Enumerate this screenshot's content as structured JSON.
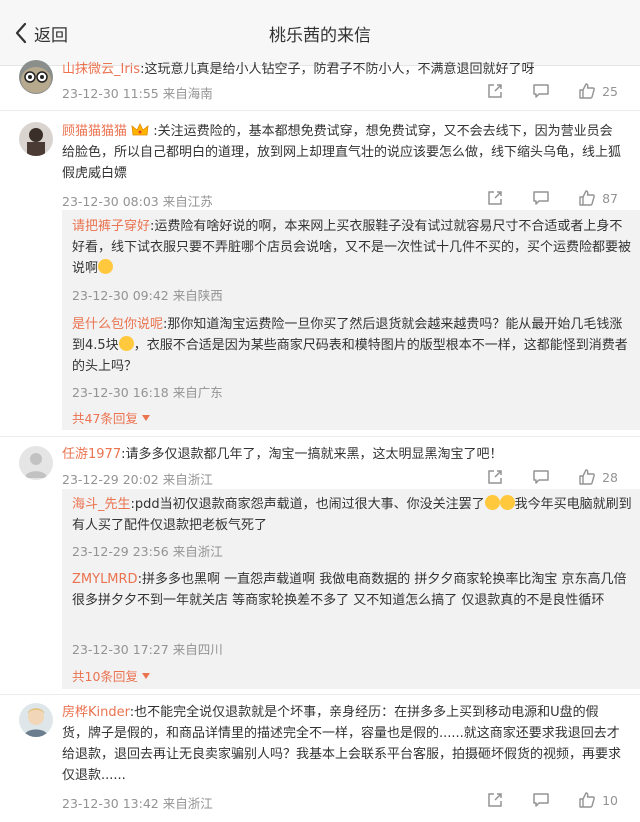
{
  "header": {
    "back_label": "返回",
    "title": "桃乐茜的来信"
  },
  "comments": [
    {
      "user": "山抹微云_Iris",
      "text": ":这玩意儿真是给小人钻空子，防君子不防小人，不满意退回就好了呀",
      "time": "23-12-30 11:55 来自海南",
      "likes": "25"
    },
    {
      "user": "顾猫猫猫猫",
      "text": ":关注运费险的，基本都想免费试穿，想免费试穿，又不会去线下，因为营业员会给脸色，所以自己都明白的道理，放到网上却理直气壮的说应该要怎么做，线下缩头乌龟，线上狐假虎威白嫖",
      "time": "23-12-30 08:03 来自江苏",
      "likes": "87",
      "replies": [
        {
          "user": "请把裤子穿好",
          "text": ":运费险有啥好说的啊，本来网上买衣服鞋子没有试过就容易尺寸不合适或者上身不好看，线下试衣服只要不弄脏哪个店员会说啥，又不是一次性试十几件不买的，买个运费险都要被说啊",
          "time": "23-12-30 09:42 来自陕西"
        },
        {
          "user": "是什么包你说呢",
          "text_a": ":那你知道淘宝运费险一旦你买了然后退货就会越来越贵吗？能从最开始几毛钱涨到4.5块",
          "text_b": "，衣服不合适是因为某些商家尺码表和模特图片的版型根本不一样，这都能怪到消费者的头上吗？",
          "time": "23-12-30 16:18 来自广东"
        }
      ],
      "more": "共47条回复"
    },
    {
      "user": "任游1977",
      "text": ":请多多仅退款都几年了，淘宝一搞就来黑，这太明显黑淘宝了吧！",
      "time": "23-12-29 20:02 来自浙江",
      "likes": "28",
      "replies": [
        {
          "user": "海斗_先生",
          "text_a": ":pdd当初仅退款商家怨声载道，也闹过很大事、你没关注罢了",
          "text_b": "我今年买电脑就刷到有人买了配件仅退款把老板气死了",
          "time": "23-12-29 23:56 来自浙江"
        },
        {
          "user": "ZMYLMRD",
          "text": ":拼多多也黑啊 一直怨声载道啊 我做电商数据的 拼夕夕商家轮换率比淘宝 京东高几倍 很多拼夕夕不到一年就关店 等商家轮换差不多了 又不知道怎么搞了 仅退款真的不是良性循环",
          "time": "23-12-30 17:27 来自四川"
        }
      ],
      "more": "共10条回复"
    },
    {
      "user": "房桦Kinder",
      "text": ":也不能完全说仅退款就是个坏事，亲身经历：在拼多多上买到移动电源和U盘的假货，牌子是假的，和商品详情里的描述完全不一样，容量也是假的......就这商家还要求我退回去才给退款，退回去再让无良卖家骗别人吗？我基本上会联系平台客服，拍摄砸坏假货的视频，再要求仅退款......",
      "time": "23-12-30 13:42 来自浙江",
      "likes": "10"
    }
  ]
}
